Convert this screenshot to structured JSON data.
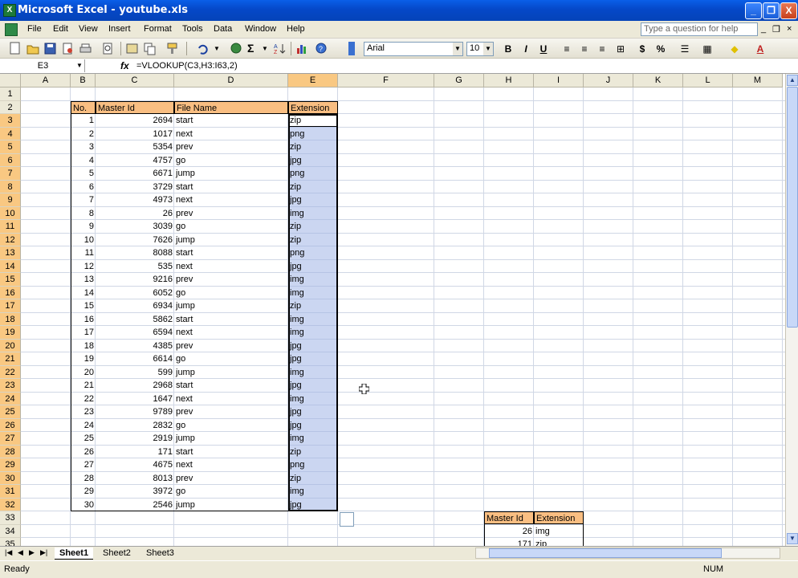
{
  "window": {
    "title": "Microsoft Excel - youtube.xls",
    "min": "_",
    "restore": "❐",
    "close": "X"
  },
  "menu": [
    "File",
    "Edit",
    "View",
    "Insert",
    "Format",
    "Tools",
    "Data",
    "Window",
    "Help"
  ],
  "help_placeholder": "Type a question for help",
  "font": {
    "name": "Arial",
    "size": "10"
  },
  "formula_bar": {
    "name_box": "E3",
    "fx": "fx",
    "formula": "=VLOOKUP(C3,H3:I63,2)"
  },
  "columns": [
    "A",
    "B",
    "C",
    "D",
    "E",
    "F",
    "G",
    "H",
    "I",
    "J",
    "K",
    "L",
    "M"
  ],
  "rows": [
    "1",
    "2",
    "3",
    "4",
    "5",
    "6",
    "7",
    "8",
    "9",
    "10",
    "11",
    "12",
    "13",
    "14",
    "15",
    "16",
    "17",
    "18",
    "19",
    "20",
    "21",
    "22",
    "23",
    "24",
    "25",
    "26",
    "27",
    "28",
    "29",
    "30",
    "31",
    "32",
    "33",
    "34",
    "35"
  ],
  "table": {
    "headers": [
      "No.",
      "Master Id",
      "File Name",
      "Extension"
    ],
    "rows": [
      [
        "1",
        "2694",
        "start",
        "zip"
      ],
      [
        "2",
        "1017",
        "next",
        "png"
      ],
      [
        "3",
        "5354",
        "prev",
        "zip"
      ],
      [
        "4",
        "4757",
        "go",
        "jpg"
      ],
      [
        "5",
        "6671",
        "jump",
        "png"
      ],
      [
        "6",
        "3729",
        "start",
        "zip"
      ],
      [
        "7",
        "4973",
        "next",
        "jpg"
      ],
      [
        "8",
        "26",
        "prev",
        "img"
      ],
      [
        "9",
        "3039",
        "go",
        "zip"
      ],
      [
        "10",
        "7626",
        "jump",
        "zip"
      ],
      [
        "11",
        "8088",
        "start",
        "png"
      ],
      [
        "12",
        "535",
        "next",
        "jpg"
      ],
      [
        "13",
        "9216",
        "prev",
        "img"
      ],
      [
        "14",
        "6052",
        "go",
        "img"
      ],
      [
        "15",
        "6934",
        "jump",
        "zip"
      ],
      [
        "16",
        "5862",
        "start",
        "img"
      ],
      [
        "17",
        "6594",
        "next",
        "img"
      ],
      [
        "18",
        "4385",
        "prev",
        "jpg"
      ],
      [
        "19",
        "6614",
        "go",
        "jpg"
      ],
      [
        "20",
        "599",
        "jump",
        "img"
      ],
      [
        "21",
        "2968",
        "start",
        "jpg"
      ],
      [
        "22",
        "1647",
        "next",
        "img"
      ],
      [
        "23",
        "9789",
        "prev",
        "jpg"
      ],
      [
        "24",
        "2832",
        "go",
        "jpg"
      ],
      [
        "25",
        "2919",
        "jump",
        "img"
      ],
      [
        "26",
        "171",
        "start",
        "zip"
      ],
      [
        "27",
        "4675",
        "next",
        "png"
      ],
      [
        "28",
        "8013",
        "prev",
        "zip"
      ],
      [
        "29",
        "3972",
        "go",
        "img"
      ],
      [
        "30",
        "2546",
        "jump",
        "jpg"
      ]
    ]
  },
  "lookup": {
    "headers": [
      "Master Id",
      "Extension"
    ],
    "rows": [
      [
        "26",
        "img"
      ],
      [
        "171",
        "zip"
      ]
    ]
  },
  "sheets": [
    "Sheet1",
    "Sheet2",
    "Sheet3"
  ],
  "status": {
    "ready": "Ready",
    "num": "NUM"
  }
}
